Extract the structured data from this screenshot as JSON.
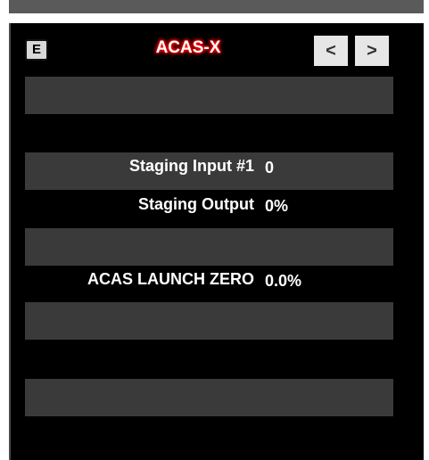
{
  "header": {
    "edit_label": "E",
    "title": "ACAS-X",
    "prev_label": "<",
    "next_label": ">"
  },
  "fields": [
    {
      "label": "Staging Input #1",
      "value": "0"
    },
    {
      "label": "Staging Output",
      "value": "0%"
    },
    {
      "label": "ACAS LAUNCH ZERO",
      "value": "0.0%"
    }
  ],
  "colors": {
    "panel_background": "#000000",
    "row_bar": "#3a3a3a",
    "title_glow": "#ff0000",
    "text": "#ffffff"
  }
}
